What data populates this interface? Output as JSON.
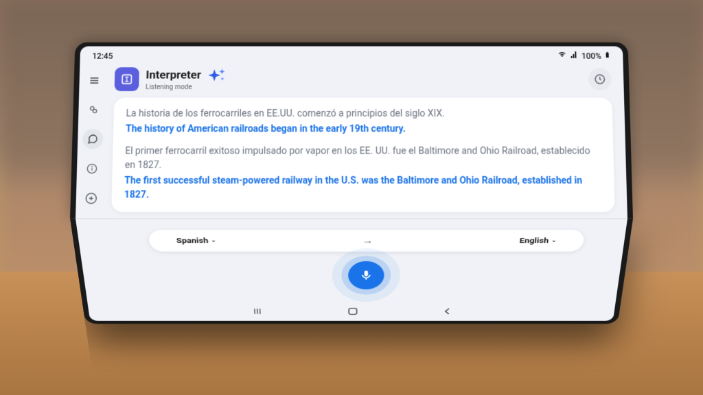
{
  "status": {
    "time": "12:45",
    "battery": "100%"
  },
  "app": {
    "title": "Interpreter",
    "subtitle": "Listening mode"
  },
  "transcript": {
    "block1_source": "La historia de los ferrocarriles en EE.UU. comenzó a principios del siglo XIX.",
    "block1_translated": "The history of American railroads began in the early 19th century.",
    "block2_source": "El primer ferrocarril exitoso impulsado por vapor en los EE. UU. fue el Baltimore and Ohio Railroad, establecido en 1827.",
    "block2_translated": "The first successful steam-powered railway in the U.S. was the Baltimore and Ohio Railroad, established in 1827."
  },
  "languages": {
    "source": "Spanish",
    "target": "English"
  },
  "colors": {
    "accent": "#1a73e8",
    "purple": "#5b5fde"
  }
}
